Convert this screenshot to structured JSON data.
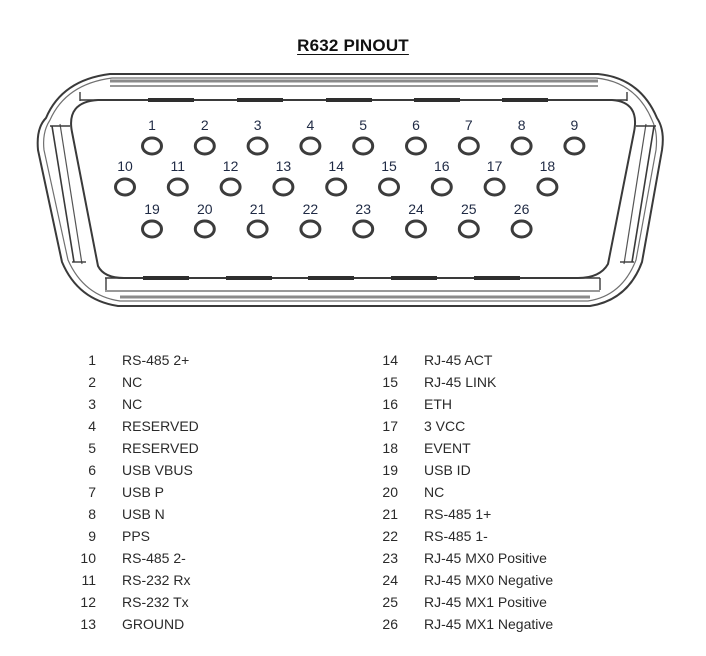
{
  "title": "R632 PINOUT",
  "connector": {
    "type": "DB-26 high density (female face view)",
    "rows": [
      [
        1,
        2,
        3,
        4,
        5,
        6,
        7,
        8,
        9
      ],
      [
        10,
        11,
        12,
        13,
        14,
        15,
        16,
        17,
        18
      ],
      [
        19,
        20,
        21,
        22,
        23,
        24,
        25,
        26
      ]
    ]
  },
  "pinout_left": [
    {
      "pin": "1",
      "signal": "RS-485 2+"
    },
    {
      "pin": "2",
      "signal": "NC"
    },
    {
      "pin": "3",
      "signal": "NC"
    },
    {
      "pin": "4",
      "signal": "RESERVED"
    },
    {
      "pin": "5",
      "signal": "RESERVED"
    },
    {
      "pin": "6",
      "signal": "USB VBUS"
    },
    {
      "pin": "7",
      "signal": "USB P"
    },
    {
      "pin": "8",
      "signal": "USB N"
    },
    {
      "pin": "9",
      "signal": "PPS"
    },
    {
      "pin": "10",
      "signal": "RS-485 2-"
    },
    {
      "pin": "11",
      "signal": "RS-232 Rx"
    },
    {
      "pin": "12",
      "signal": "RS-232 Tx"
    },
    {
      "pin": "13",
      "signal": "GROUND"
    }
  ],
  "pinout_right": [
    {
      "pin": "14",
      "signal": "RJ-45 ACT"
    },
    {
      "pin": "15",
      "signal": "RJ-45 LINK"
    },
    {
      "pin": "16",
      "signal": "ETH"
    },
    {
      "pin": "17",
      "signal": "3 VCC"
    },
    {
      "pin": "18",
      "signal": "EVENT"
    },
    {
      "pin": "19",
      "signal": "USB ID"
    },
    {
      "pin": "20",
      "signal": "NC"
    },
    {
      "pin": "21",
      "signal": "RS-485 1+"
    },
    {
      "pin": "22",
      "signal": "RS-485 1-"
    },
    {
      "pin": "23",
      "signal": "RJ-45 MX0 Positive"
    },
    {
      "pin": "24",
      "signal": "RJ-45 MX0 Negative"
    },
    {
      "pin": "25",
      "signal": "RJ-45 MX1 Positive"
    },
    {
      "pin": "26",
      "signal": "RJ-45 MX1 Negative"
    }
  ]
}
